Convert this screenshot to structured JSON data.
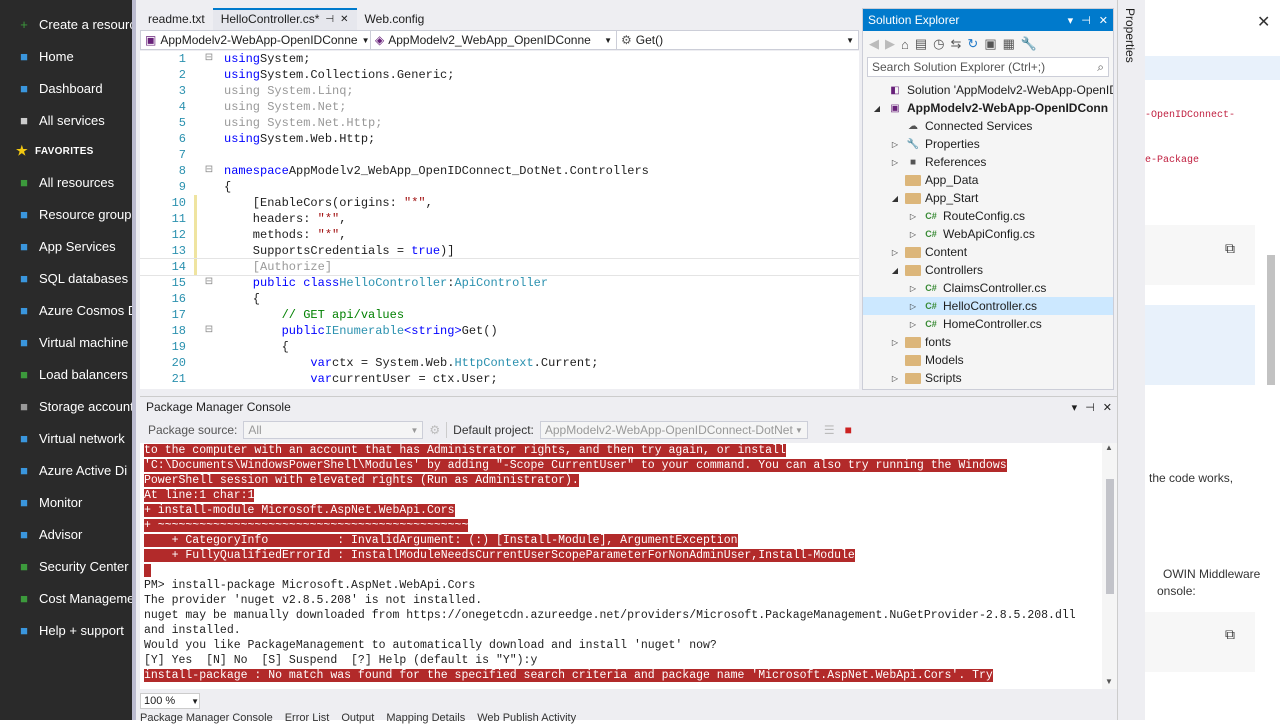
{
  "azure_sidebar": {
    "items": [
      {
        "icon": "plus-icon",
        "label": "Create a resource",
        "color": "#3c9a3c"
      },
      {
        "icon": "home-icon",
        "label": "Home",
        "color": "#3a96dd"
      },
      {
        "icon": "dashboard-icon",
        "label": "Dashboard",
        "color": "#3a96dd"
      },
      {
        "icon": "list-icon",
        "label": "All services",
        "color": "#ccc"
      },
      {
        "icon": "star-icon",
        "label": "FAVORITES",
        "color": "#f2c811"
      },
      {
        "icon": "grid-icon",
        "label": "All resources",
        "color": "#3c9a3c"
      },
      {
        "icon": "resource-group-icon",
        "label": "Resource group",
        "color": "#3a96dd"
      },
      {
        "icon": "app-services-icon",
        "label": "App Services",
        "color": "#3a96dd"
      },
      {
        "icon": "sql-icon",
        "label": "SQL databases",
        "color": "#3a96dd"
      },
      {
        "icon": "cosmos-icon",
        "label": "Azure Cosmos D",
        "color": "#3a96dd"
      },
      {
        "icon": "vm-icon",
        "label": "Virtual machine",
        "color": "#3a96dd"
      },
      {
        "icon": "load-balancer-icon",
        "label": "Load balancers",
        "color": "#3c9a3c"
      },
      {
        "icon": "storage-icon",
        "label": "Storage account",
        "color": "#999"
      },
      {
        "icon": "network-icon",
        "label": "Virtual network",
        "color": "#3a96dd"
      },
      {
        "icon": "active-directory-icon",
        "label": "Azure Active Di",
        "color": "#3a96dd"
      },
      {
        "icon": "monitor-icon",
        "label": "Monitor",
        "color": "#3a96dd"
      },
      {
        "icon": "advisor-icon",
        "label": "Advisor",
        "color": "#3a96dd"
      },
      {
        "icon": "security-icon",
        "label": "Security Center",
        "color": "#3c9a3c"
      },
      {
        "icon": "cost-icon",
        "label": "Cost Manageme",
        "color": "#3c9a3c"
      },
      {
        "icon": "help-icon",
        "label": "Help + support",
        "color": "#3a96dd"
      }
    ]
  },
  "editor_tabs": [
    {
      "label": "readme.txt",
      "active": false
    },
    {
      "label": "HelloController.cs*",
      "active": true
    },
    {
      "label": "Web.config",
      "active": false
    }
  ],
  "navbar": {
    "project": "AppModelv2-WebApp-OpenIDConne",
    "class": "AppModelv2_WebApp_OpenIDConne",
    "member": "Get()"
  },
  "code": [
    {
      "n": "1",
      "t": [
        [
          "kw",
          "using"
        ],
        [
          "",
          "System;"
        ]
      ]
    },
    {
      "n": "2",
      "t": [
        [
          "kw",
          "using"
        ],
        [
          "",
          "System.Collections.Generic;"
        ]
      ]
    },
    {
      "n": "3",
      "t": [
        [
          "gr",
          "using System.Linq;"
        ]
      ]
    },
    {
      "n": "4",
      "t": [
        [
          "gr",
          "using System.Net;"
        ]
      ]
    },
    {
      "n": "5",
      "t": [
        [
          "gr",
          "using System.Net.Http;"
        ]
      ]
    },
    {
      "n": "6",
      "t": [
        [
          "kw",
          "using"
        ],
        [
          "",
          "System.Web.Http;"
        ]
      ]
    },
    {
      "n": "7",
      "t": []
    },
    {
      "n": "8",
      "t": [
        [
          "kw",
          "namespace"
        ],
        [
          "",
          "AppModelv2_WebApp_OpenIDConnect_DotNet.Controllers"
        ]
      ]
    },
    {
      "n": "9",
      "t": [
        [
          "",
          "{"
        ]
      ]
    },
    {
      "n": "10",
      "t": [
        [
          "",
          "    [EnableCors(origins: "
        ],
        [
          "st",
          "\"*\""
        ],
        [
          "",
          ","
        ]
      ]
    },
    {
      "n": "11",
      "t": [
        [
          "",
          "    headers: "
        ],
        [
          "st",
          "\"*\""
        ],
        [
          "",
          ","
        ]
      ]
    },
    {
      "n": "12",
      "t": [
        [
          "",
          "    methods: "
        ],
        [
          "st",
          "\"*\""
        ],
        [
          "",
          ","
        ]
      ]
    },
    {
      "n": "13",
      "t": [
        [
          "",
          "    SupportsCredentials = "
        ],
        [
          "kw",
          "true"
        ],
        [
          "",
          ")]"
        ]
      ]
    },
    {
      "n": "14",
      "t": [
        [
          "gr",
          "    [Authorize]"
        ]
      ]
    },
    {
      "n": "15",
      "t": [
        [
          "kw",
          "    public class"
        ],
        [
          "ty",
          "HelloController"
        ],
        [
          "",
          ":"
        ],
        [
          "ty",
          "ApiController"
        ]
      ]
    },
    {
      "n": "16",
      "t": [
        [
          "",
          "    {"
        ]
      ]
    },
    {
      "n": "17",
      "t": [
        [
          "cm",
          "        // GET api/values"
        ]
      ]
    },
    {
      "n": "18",
      "t": [
        [
          "kw",
          "        public"
        ],
        [
          "ty",
          "IEnumerable"
        ],
        [
          "kw",
          "<string>"
        ],
        [
          "",
          "Get()"
        ]
      ]
    },
    {
      "n": "19",
      "t": [
        [
          "",
          "        {"
        ]
      ]
    },
    {
      "n": "20",
      "t": [
        [
          "kw",
          "            var"
        ],
        [
          "",
          "ctx = System.Web."
        ],
        [
          "ty",
          "HttpContext"
        ],
        [
          "",
          ".Current;"
        ]
      ]
    },
    {
      "n": "21",
      "t": [
        [
          "kw",
          "            var"
        ],
        [
          "",
          "currentUser = ctx.User;"
        ]
      ]
    }
  ],
  "solution_explorer": {
    "title": "Solution Explorer",
    "search_placeholder": "Search Solution Explorer (Ctrl+;)",
    "tree": [
      {
        "label": "Solution 'AppModelv2-WebApp-OpenIDC",
        "indent": 0,
        "arrow": "",
        "icon": "solution",
        "sel": false,
        "bold": false
      },
      {
        "label": "AppModelv2-WebApp-OpenIDConn",
        "indent": 0,
        "arrow": "◢",
        "icon": "project",
        "sel": false,
        "bold": true
      },
      {
        "label": "Connected Services",
        "indent": 1,
        "arrow": "",
        "icon": "connected",
        "sel": false,
        "bold": false
      },
      {
        "label": "Properties",
        "indent": 1,
        "arrow": "▷",
        "icon": "wrench",
        "sel": false,
        "bold": false
      },
      {
        "label": "References",
        "indent": 1,
        "arrow": "▷",
        "icon": "ref",
        "sel": false,
        "bold": false
      },
      {
        "label": "App_Data",
        "indent": 1,
        "arrow": "",
        "icon": "folder",
        "sel": false,
        "bold": false
      },
      {
        "label": "App_Start",
        "indent": 1,
        "arrow": "◢",
        "icon": "folder",
        "sel": false,
        "bold": false
      },
      {
        "label": "RouteConfig.cs",
        "indent": 2,
        "arrow": "▷",
        "icon": "cs",
        "sel": false,
        "bold": false
      },
      {
        "label": "WebApiConfig.cs",
        "indent": 2,
        "arrow": "▷",
        "icon": "cs",
        "sel": false,
        "bold": false
      },
      {
        "label": "Content",
        "indent": 1,
        "arrow": "▷",
        "icon": "folder",
        "sel": false,
        "bold": false
      },
      {
        "label": "Controllers",
        "indent": 1,
        "arrow": "◢",
        "icon": "folder",
        "sel": false,
        "bold": false
      },
      {
        "label": "ClaimsController.cs",
        "indent": 2,
        "arrow": "▷",
        "icon": "cs",
        "sel": false,
        "bold": false
      },
      {
        "label": "HelloController.cs",
        "indent": 2,
        "arrow": "▷",
        "icon": "cs",
        "sel": true,
        "bold": false
      },
      {
        "label": "HomeController.cs",
        "indent": 2,
        "arrow": "▷",
        "icon": "cs",
        "sel": false,
        "bold": false
      },
      {
        "label": "fonts",
        "indent": 1,
        "arrow": "▷",
        "icon": "folder",
        "sel": false,
        "bold": false
      },
      {
        "label": "Models",
        "indent": 1,
        "arrow": "",
        "icon": "folder",
        "sel": false,
        "bold": false
      },
      {
        "label": "Scripts",
        "indent": 1,
        "arrow": "▷",
        "icon": "folder",
        "sel": false,
        "bold": false
      }
    ]
  },
  "pmc": {
    "title": "Package Manager Console",
    "source_label": "Package source:",
    "source_value": "All",
    "project_label": "Default project:",
    "project_value": "AppModelv2-WebApp-OpenIDConnect-DotNet",
    "zoom": "100 %",
    "lines": [
      {
        "err": true,
        "text": "to the computer with an account that has Administrator rights, and then try again, or install"
      },
      {
        "err": true,
        "text": "'C:\\Documents\\WindowsPowerShell\\Modules' by adding \"-Scope CurrentUser\" to your command. You can also try running the Windows"
      },
      {
        "err": true,
        "text": "PowerShell session with elevated rights (Run as Administrator)."
      },
      {
        "err": true,
        "text": "At line:1 char:1"
      },
      {
        "err": true,
        "text": "+ install-module Microsoft.AspNet.WebApi.Cors"
      },
      {
        "err": true,
        "text": "+ ~~~~~~~~~~~~~~~~~~~~~~~~~~~~~~~~~~~~~~~~~~~~~"
      },
      {
        "err": true,
        "text": "    + CategoryInfo          : InvalidArgument: (:) [Install-Module], ArgumentException"
      },
      {
        "err": true,
        "text": "    + FullyQualifiedErrorId : InstallModuleNeedsCurrentUserScopeParameterForNonAdminUser,Install-Module"
      },
      {
        "err": true,
        "text": " "
      },
      {
        "err": false,
        "text": "PM> install-package Microsoft.AspNet.WebApi.Cors"
      },
      {
        "err": false,
        "text": "The provider 'nuget v2.8.5.208' is not installed."
      },
      {
        "err": false,
        "text": "nuget may be manually downloaded from https://onegetcdn.azureedge.net/providers/Microsoft.PackageManagement.NuGetProvider-2.8.5.208.dll"
      },
      {
        "err": false,
        "text": "and installed."
      },
      {
        "err": false,
        "text": "Would you like PackageManagement to automatically download and install 'nuget' now?"
      },
      {
        "err": false,
        "text": "[Y] Yes  [N] No  [S] Suspend  [?] Help (default is \"Y\"):y"
      },
      {
        "err": true,
        "text": "install-package : No match was found for the specified search criteria and package name 'Microsoft.AspNet.WebApi.Cors'. Try"
      }
    ]
  },
  "bottom_tabs": [
    "Package Manager Console",
    "Error List",
    "Output",
    "Mapping Details",
    "Web Publish Activity"
  ],
  "properties_label": "Properties",
  "azure_right": {
    "text1": "-OpenIDConnect-",
    "text2": "e-Package",
    "text3": "the code works,",
    "text4": "OWIN Middleware",
    "text5": "onsole:"
  }
}
